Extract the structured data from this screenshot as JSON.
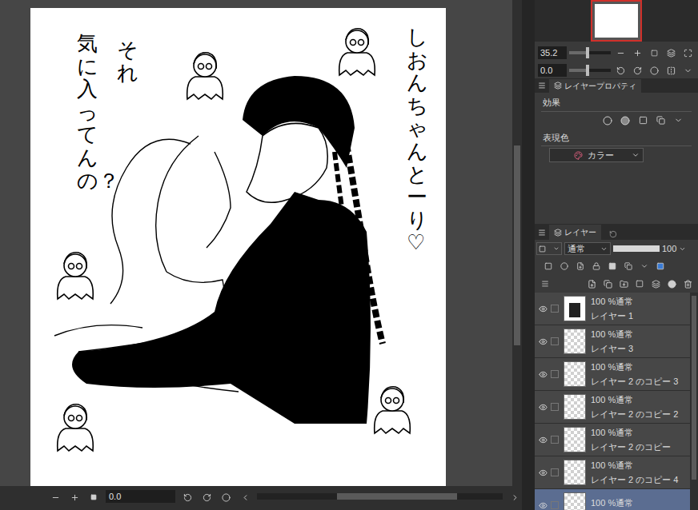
{
  "canvas": {
    "left_line_1": "それ",
    "left_line_2": "気に入ってんの？",
    "right_line": "しおんちゃんとーり♡"
  },
  "navigator": {
    "zoom": "35.2",
    "zoom_level": 0.45,
    "rotation": "0.0",
    "rotation_level": 0.45
  },
  "layer_property": {
    "title": "レイヤープロパティ",
    "effect_label": "効果",
    "color_label": "表現色",
    "color_mode": "カラー"
  },
  "layer_panel": {
    "tab": "レイヤー",
    "blend_mode": "通常",
    "opacity": "100",
    "opacity_level": 1,
    "layers": [
      {
        "mode": "100 %通常",
        "name": "レイヤー 1",
        "kind": "image",
        "visible": true,
        "selected": false
      },
      {
        "mode": "100 %通常",
        "name": "レイヤー 3",
        "kind": "empty",
        "visible": true,
        "selected": false
      },
      {
        "mode": "100 %通常",
        "name": "レイヤー 2 のコピー 3",
        "kind": "empty",
        "visible": true,
        "selected": false
      },
      {
        "mode": "100 %通常",
        "name": "レイヤー 2 のコピー 2",
        "kind": "empty",
        "visible": true,
        "selected": false
      },
      {
        "mode": "100 %通常",
        "name": "レイヤー 2 のコピー",
        "kind": "empty",
        "visible": true,
        "selected": false
      },
      {
        "mode": "100 %通常",
        "name": "レイヤー 2 のコピー 4",
        "kind": "empty",
        "visible": true,
        "selected": false
      },
      {
        "mode": "100 %通常",
        "name": "",
        "kind": "empty",
        "visible": true,
        "selected": true
      }
    ]
  },
  "bottom_bar": {
    "rotation": "0.0"
  }
}
